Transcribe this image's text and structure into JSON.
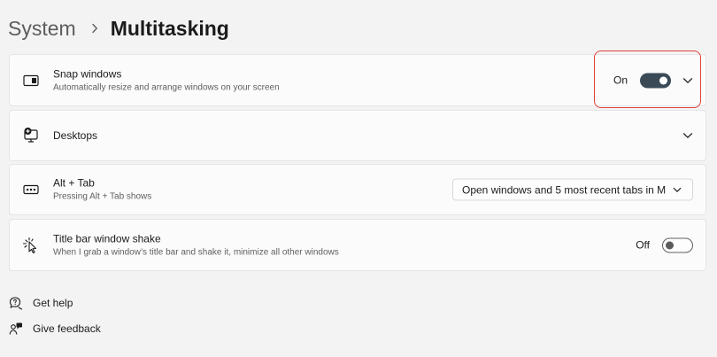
{
  "breadcrumb": {
    "parent": "System",
    "current": "Multitasking"
  },
  "cards": {
    "snap": {
      "title": "Snap windows",
      "description": "Automatically resize and arrange windows on your screen",
      "toggle_label": "On",
      "toggle_state": "on"
    },
    "desktops": {
      "title": "Desktops"
    },
    "alttab": {
      "title": "Alt + Tab",
      "description": "Pressing Alt + Tab shows",
      "dropdown_value": "Open windows and 5 most recent tabs in M"
    },
    "shake": {
      "title": "Title bar window shake",
      "description": "When I grab a window’s title bar and shake it, minimize all other windows",
      "toggle_label": "Off",
      "toggle_state": "off"
    }
  },
  "footer": {
    "help": "Get help",
    "feedback": "Give feedback"
  },
  "colors": {
    "accent_toggle_on": "#3a4a57",
    "highlight_border": "#e0413a",
    "background": "#f3f3f3"
  },
  "icons": {
    "breadcrumb_separator": "chevron-right-icon",
    "snap": "snap-windows-icon",
    "desktops": "desktops-icon",
    "alttab": "alt-tab-icon",
    "shake": "window-shake-icon",
    "help": "help-icon",
    "feedback": "feedback-icon"
  }
}
